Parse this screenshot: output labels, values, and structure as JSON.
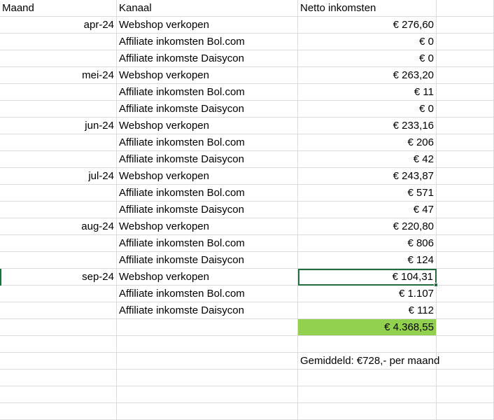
{
  "sheet": {
    "headers": [
      "Maand",
      "Kanaal",
      "Netto inkomsten"
    ],
    "rows": [
      [
        "apr-24",
        "Webshop verkopen",
        "€ 276,60"
      ],
      [
        "",
        "Affiliate inkomsten Bol.com",
        "€ 0"
      ],
      [
        "",
        "Affiliate inkomste Daisycon",
        "€ 0"
      ],
      [
        "mei-24",
        "Webshop verkopen",
        "€ 263,20"
      ],
      [
        "",
        "Affiliate inkomsten Bol.com",
        "€ 11"
      ],
      [
        "",
        "Affiliate inkomste Daisycon",
        "€ 0"
      ],
      [
        "jun-24",
        "Webshop verkopen",
        "€ 233,16"
      ],
      [
        "",
        "Affiliate inkomsten Bol.com",
        "€ 206"
      ],
      [
        "",
        "Affiliate inkomste Daisycon",
        "€ 42"
      ],
      [
        "jul-24",
        "Webshop verkopen",
        "€ 243,87"
      ],
      [
        "",
        "Affiliate inkomsten Bol.com",
        "€ 571"
      ],
      [
        "",
        "Affiliate inkomste Daisycon",
        "€ 47"
      ],
      [
        "aug-24",
        "Webshop verkopen",
        "€ 220,80"
      ],
      [
        "",
        "Affiliate inkomsten Bol.com",
        "€ 806"
      ],
      [
        "",
        "Affiliate inkomste Daisycon",
        "€ 124"
      ],
      [
        "sep-24",
        "Webshop verkopen",
        "€ 104,31"
      ],
      [
        "",
        "Affiliate inkomsten Bol.com",
        "€ 1.107"
      ],
      [
        "",
        "Affiliate inkomste Daisycon",
        "€ 112"
      ],
      [
        "",
        "",
        "€ 4.368,55"
      ],
      [
        "",
        "",
        ""
      ],
      [
        "",
        "",
        "Gemiddeld: €728,- per maand"
      ],
      [
        "",
        "",
        ""
      ],
      [
        "",
        "",
        ""
      ]
    ],
    "selected_cell": {
      "row": 16,
      "col": 2
    },
    "total_row": 19,
    "note_row": 21
  },
  "colors": {
    "total_fill": "#92d050",
    "selection": "#1e6e40",
    "gridline": "#dadcdf"
  }
}
